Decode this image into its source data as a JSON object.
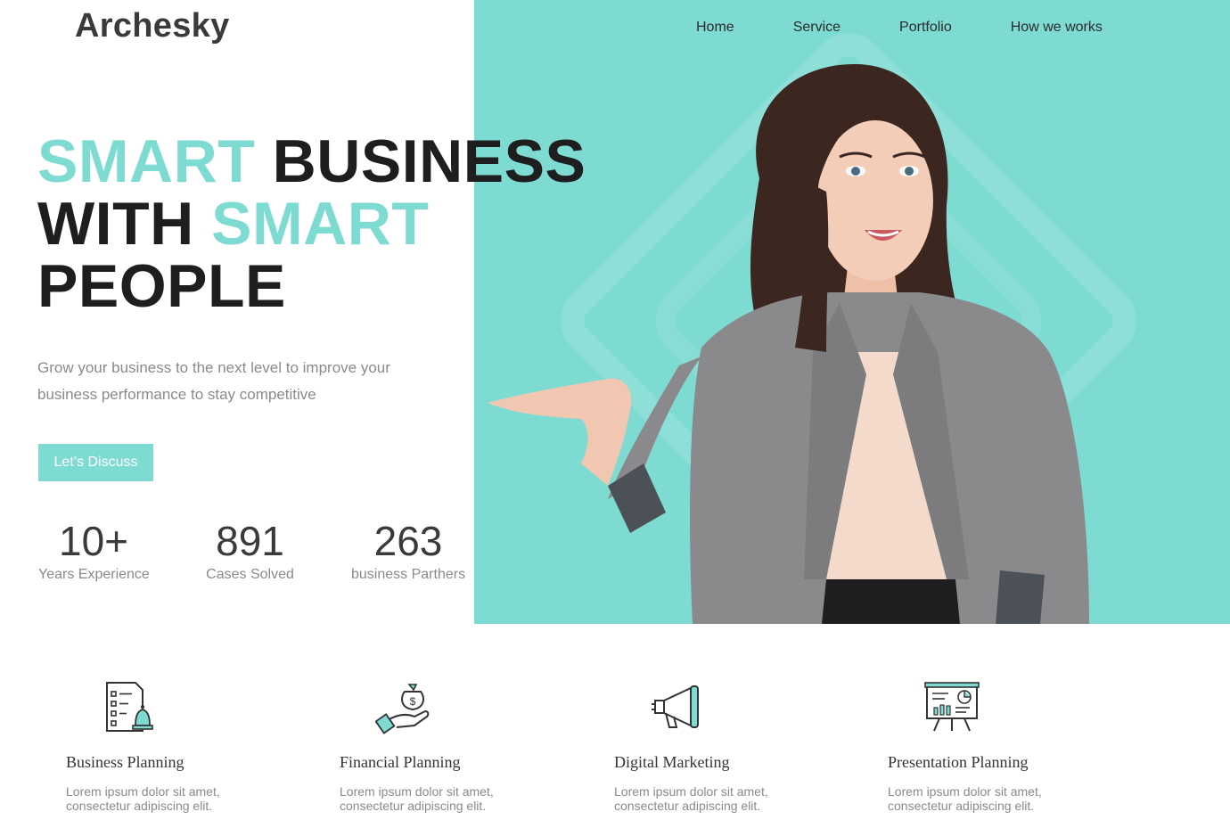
{
  "brand": {
    "logo": "Archesky",
    "accent_color": "#7edbd2"
  },
  "nav": {
    "items": [
      "Home",
      "Service",
      "Portfolio",
      "How we works"
    ]
  },
  "hero": {
    "headline": {
      "line1_accent": "SMART",
      "line1_rest": "BUSINESS",
      "line2_start": "WITH",
      "line2_accent": "SMART",
      "line3": "PEOPLE"
    },
    "subtitle": "Grow your business to the next level to improve your business performance to stay competitive",
    "cta_label": "Let’s Discuss"
  },
  "stats": [
    {
      "value": "10+",
      "label": "Years Experience"
    },
    {
      "value": "891",
      "label": "Cases Solved"
    },
    {
      "value": "263",
      "label": "business Parthers"
    }
  ],
  "services": [
    {
      "title": "Business Planning",
      "desc_line1": "Lorem ipsum dolor sit amet,",
      "desc_line2": "consectetur adipiscing elit.",
      "icon": "checklist-bell-icon"
    },
    {
      "title": "Financial Planning",
      "desc_line1": "Lorem ipsum dolor sit amet,",
      "desc_line2": "consectetur adipiscing elit.",
      "icon": "money-bag-hand-icon"
    },
    {
      "title": "Digital Marketing",
      "desc_line1": "Lorem ipsum dolor sit amet,",
      "desc_line2": "consectetur adipiscing elit.",
      "icon": "megaphone-icon"
    },
    {
      "title": "Presentation Planning",
      "desc_line1": "Lorem ipsum dolor sit amet,",
      "desc_line2": "consectetur adipiscing elit.",
      "icon": "presentation-board-icon"
    }
  ]
}
